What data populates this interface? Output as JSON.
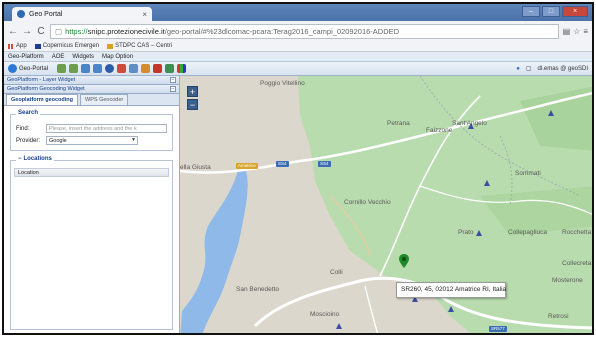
{
  "browser": {
    "tab_title": "Geo Portal",
    "url_scheme": "https://",
    "url_host": "snipc.protezionecivile.it",
    "url_path": "/geo-portal/#%23dlcomac-pcara:Terag2016_campi_02092016-ADDED"
  },
  "bookmarks": [
    {
      "label": "App"
    },
    {
      "label": "Copernicus Emergen"
    },
    {
      "label": "STDPC CAS – Centri"
    }
  ],
  "menu": [
    "Geo-Platform",
    "AOE",
    "Widgets",
    "Map Option"
  ],
  "toolbar": {
    "brand": "Geo-Portal",
    "user": "dl.emas @ geoSDI"
  },
  "panel": {
    "layer_widget": "GeoPlatform - Layer Widget",
    "geocoding_widget": "GeoPlatform Geocoding Widget",
    "tabs": [
      {
        "label": "Geoplatform geocoding",
        "active": true
      },
      {
        "label": "WPS Geocoder",
        "active": false
      }
    ],
    "search_legend": "Search",
    "find_label": "Find:",
    "find_placeholder": "Please, insert the address and the k",
    "provider_label": "Provider:",
    "provider_value": "Google",
    "locations_legend": "Locations",
    "locations_column": "Location"
  },
  "map": {
    "zoom_in": "+",
    "zoom_out": "−",
    "popup_text": "SR260, 45, 02012 Amatrice RI, Italia",
    "places": [
      {
        "name": "Poggio Vitellino"
      },
      {
        "name": "Petrana"
      },
      {
        "name": "Faizzone"
      },
      {
        "name": "Sant'Angelo"
      },
      {
        "name": "Sommati"
      },
      {
        "name": "Cornillo Vecchio"
      },
      {
        "name": "Prato"
      },
      {
        "name": "Collepagliuca"
      },
      {
        "name": "Rocchetta"
      },
      {
        "name": "Collecreta"
      },
      {
        "name": "Colli"
      },
      {
        "name": "San Benedetto"
      },
      {
        "name": "Moscioino"
      },
      {
        "name": "Retrosi"
      },
      {
        "name": "Mosterone"
      },
      {
        "name": "ella Giusta"
      }
    ],
    "shields": [
      "Amatrice",
      "SS4",
      "SS4",
      "SR577"
    ],
    "colors": {
      "green_area": "#b8dcae",
      "lake": "#8fb9e8",
      "popup_marker": "#2f9a36"
    }
  }
}
